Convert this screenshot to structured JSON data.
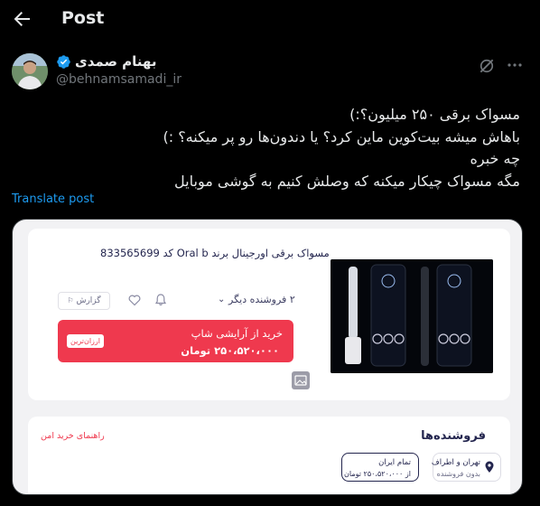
{
  "header": {
    "title": "Post"
  },
  "author": {
    "name": "بهنام صمدی",
    "handle": "@behnamsamadi_ir"
  },
  "tweet": {
    "lines": [
      "مسواک برقی ۲۵۰ میلیون؟:)",
      "باهاش میشه بیت‌کوین ماین کرد؟ یا دندون‌ها رو پر میکنه؟ :)",
      "چه خبره",
      "مگه مسواک چیکار میکنه که وصلش کنیم به گوشی موبایل"
    ],
    "translate_label": "Translate post"
  },
  "product_card": {
    "title": "مسواک برقی اورجینال برند Oral b کد 833565699",
    "other_sellers": "۲ فروشنده دیگر",
    "report_label": "گزارش",
    "shop_name": "خرید از آرایشی شاپ",
    "shop_price": "۲۵۰،۵۲۰،۰۰۰ تومان",
    "cheapest_badge": "ارزان‌ترین"
  },
  "sellers_section": {
    "title": "فروشنده‌ها",
    "safe_guide": "راهنمای خرید امن",
    "location_line1": "تهران و اطراف",
    "location_line2": "بدون فروشنده",
    "iran_line1": "تمام ایران",
    "iran_line2": "از ۲۵۰،۵۲۰،۰۰۰ تومان"
  },
  "colors": {
    "accent": "#1d9bf0",
    "brand_red": "#ef394e",
    "text": "#e7e9ea",
    "muted": "#71767b"
  }
}
